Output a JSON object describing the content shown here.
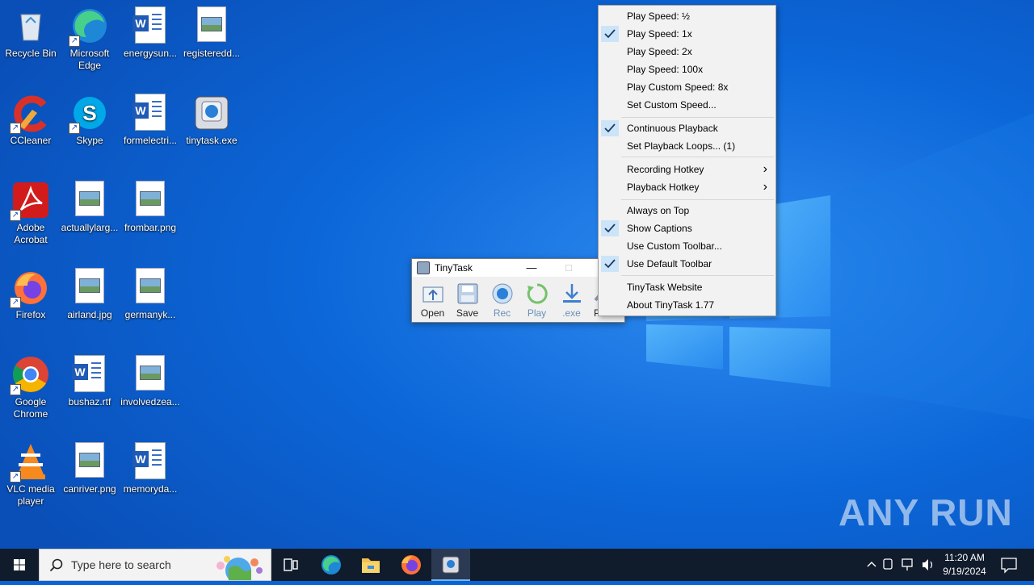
{
  "desktop": {
    "icons": [
      {
        "label": "Recycle Bin",
        "icon": "recycle-bin-icon"
      },
      {
        "label": "Microsoft Edge",
        "icon": "edge-icon"
      },
      {
        "label": "energysun...",
        "icon": "word-doc-icon"
      },
      {
        "label": "registeredd...",
        "icon": "image-file-icon"
      },
      {
        "label": "CCleaner",
        "icon": "ccleaner-icon"
      },
      {
        "label": "Skype",
        "icon": "skype-icon"
      },
      {
        "label": "formelectri...",
        "icon": "word-doc-icon"
      },
      {
        "label": "tinytask.exe",
        "icon": "tinytask-icon"
      },
      {
        "label": "Adobe Acrobat",
        "icon": "acrobat-icon"
      },
      {
        "label": "actuallylarg...",
        "icon": "image-file-icon"
      },
      {
        "label": "frombar.png",
        "icon": "image-file-icon"
      },
      {
        "label": "Firefox",
        "icon": "firefox-icon"
      },
      {
        "label": "airland.jpg",
        "icon": "image-file-icon"
      },
      {
        "label": "germanyk...",
        "icon": "image-file-icon"
      },
      {
        "label": "Google Chrome",
        "icon": "chrome-icon"
      },
      {
        "label": "bushaz.rtf",
        "icon": "word-doc-icon"
      },
      {
        "label": "involvedzea...",
        "icon": "image-file-icon"
      },
      {
        "label": "VLC media player",
        "icon": "vlc-icon"
      },
      {
        "label": "canriver.png",
        "icon": "image-file-icon"
      },
      {
        "label": "memoryda...",
        "icon": "word-doc-icon"
      }
    ]
  },
  "tinytask": {
    "title": "TinyTask",
    "buttons": [
      {
        "label": "Open",
        "icon": "open-icon"
      },
      {
        "label": "Save",
        "icon": "save-icon"
      },
      {
        "label": "Rec",
        "icon": "record-icon"
      },
      {
        "label": "Play",
        "icon": "play-icon"
      },
      {
        "label": ".exe",
        "icon": "compile-exe-icon"
      },
      {
        "label": "P",
        "icon": "prefs-icon"
      }
    ]
  },
  "menu": {
    "items": [
      {
        "label": "Play Speed:  ½",
        "checked": false
      },
      {
        "label": "Play Speed:  1x",
        "checked": true
      },
      {
        "label": "Play Speed:  2x",
        "checked": false
      },
      {
        "label": "Play Speed:  100x",
        "checked": false
      },
      {
        "label": "Play Custom Speed:  8x",
        "checked": false
      },
      {
        "label": "Set Custom Speed...",
        "checked": false
      },
      {
        "label": "Continuous Playback",
        "checked": true
      },
      {
        "label": "Set Playback Loops...  (1)",
        "checked": false
      },
      {
        "label": "Recording Hotkey",
        "checked": false,
        "submenu": true
      },
      {
        "label": "Playback Hotkey",
        "checked": false,
        "submenu": true
      },
      {
        "label": "Always on Top",
        "checked": false
      },
      {
        "label": "Show Captions",
        "checked": true
      },
      {
        "label": "Use Custom Toolbar...",
        "checked": false
      },
      {
        "label": "Use Default Toolbar",
        "checked": true
      },
      {
        "label": "TinyTask Website",
        "checked": false
      },
      {
        "label": "About TinyTask 1.77",
        "checked": false
      }
    ]
  },
  "taskbar": {
    "search_placeholder": "Type here to search",
    "time": "11:20 AM",
    "date": "9/19/2024",
    "apps": [
      "task-view-icon",
      "edge-icon",
      "file-explorer-icon",
      "firefox-icon",
      "tinytask-icon"
    ]
  },
  "watermark": "ANY RUN",
  "colors": {
    "accent": "#0a63d4",
    "menu_check_bg": "#cce4f7",
    "taskbar": "#101b2c"
  }
}
